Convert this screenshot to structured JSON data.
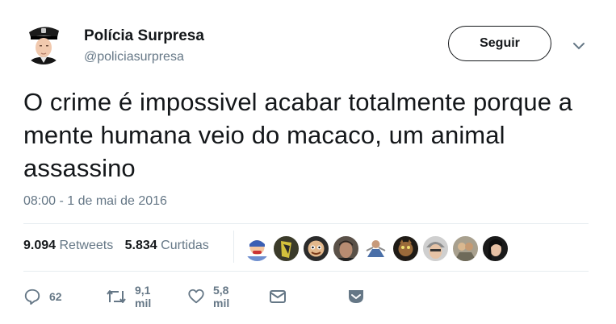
{
  "account": {
    "display_name": "Polícia Surpresa",
    "handle": "@policiasurpresa",
    "follow_label": "Seguir"
  },
  "tweet": {
    "text": "O crime é impossivel acabar totalmente porque a mente humana veio do macaco, um animal assassino",
    "timestamp": "08:00 - 1 de mai de 2016"
  },
  "stats": {
    "retweets_count": "9.094",
    "retweets_label": "Retweets",
    "likes_count": "5.834",
    "likes_label": "Curtidas"
  },
  "actions": {
    "reply_count": "62",
    "retweet_count": "9,1 mil",
    "like_count": "5,8 mil"
  },
  "icons": [
    "reply-icon",
    "retweet-icon",
    "heart-icon",
    "envelope-icon",
    "save-icon",
    "chevron-down-icon"
  ],
  "colors": {
    "text": "#14171a",
    "secondary": "#657786",
    "divider": "#e6ecf0"
  }
}
